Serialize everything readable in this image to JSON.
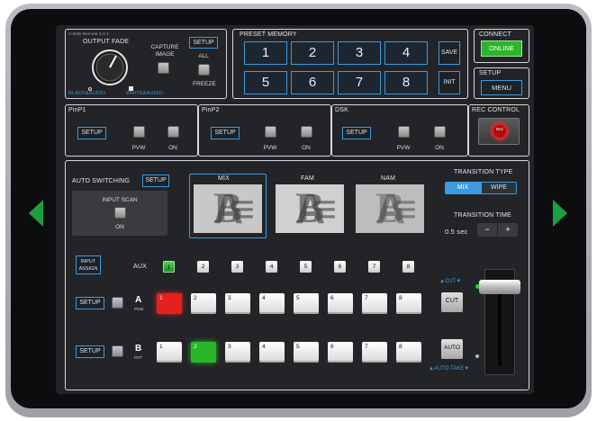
{
  "device": {
    "version": "V-8HD Remote 1.0.1"
  },
  "output_fade": {
    "title": "OUTPUT FADE",
    "left_label": "BLACK&AUDIO",
    "right_label": "WHITE&AUDIO"
  },
  "capture": {
    "label": "CAPTURE IMAGE"
  },
  "top_setup": {
    "label": "SETUP",
    "all_label": "ALL",
    "freeze_label": "FREEZE"
  },
  "preset_memory": {
    "title": "PRESET MEMORY",
    "buttons": [
      "1",
      "2",
      "3",
      "4",
      "5",
      "6",
      "7",
      "8"
    ],
    "save_label": "SAVE",
    "init_label": "INIT"
  },
  "connect": {
    "title": "CONNECT",
    "button": "ONLINE"
  },
  "setup_menu": {
    "title": "SETUP",
    "button": "MENU"
  },
  "pinp1": {
    "title": "PinP1",
    "setup": "SETUP",
    "pvw": "PVW",
    "on": "ON"
  },
  "pinp2": {
    "title": "PinP2",
    "setup": "SETUP",
    "pvw": "PVW",
    "on": "ON"
  },
  "dsk": {
    "title": "DSK",
    "setup": "SETUP",
    "pvw": "PVW",
    "on": "ON"
  },
  "rec_control": {
    "title": "REC CONTROL",
    "button": "Rec"
  },
  "auto_switching": {
    "title": "AUTO SWITCHING",
    "setup": "SETUP",
    "input_scan": "INPUT SCAN",
    "on": "ON"
  },
  "transition_thumbs": [
    {
      "label": "MIX"
    },
    {
      "label": "FAM"
    },
    {
      "label": "NAM"
    }
  ],
  "transition_type": {
    "title": "TRANSITION TYPE",
    "options": [
      "MIX",
      "WIPE"
    ],
    "selected": "MIX"
  },
  "transition_time": {
    "title": "TRANSITION TIME",
    "value": "0.5 sec",
    "minus": "−",
    "plus": "+"
  },
  "input_assign": {
    "label": "INPUT ASSIGN"
  },
  "aux_row": {
    "label": "AUX",
    "buttons": [
      "1",
      "2",
      "3",
      "4",
      "5",
      "6",
      "7",
      "8"
    ],
    "active_index": 0
  },
  "a_bus": {
    "setup": "SETUP",
    "letter": "A",
    "sub": "PGM",
    "buttons": [
      "1",
      "2",
      "3",
      "4",
      "5",
      "6",
      "7",
      "8"
    ],
    "active_index": 0,
    "active_color": "#e52020"
  },
  "b_bus": {
    "setup": "SETUP",
    "letter": "B",
    "sub": "PST",
    "buttons": [
      "1",
      "2",
      "3",
      "4",
      "5",
      "6",
      "7",
      "8"
    ],
    "active_index": 1,
    "active_color": "#2bb52b"
  },
  "cut": {
    "top_label": "▲CUT▼",
    "button": "CUT"
  },
  "auto": {
    "button": "AUTO",
    "bottom_label": "▲AUTO TAKE▼"
  },
  "nav": {
    "left": "previous-arrow-icon",
    "right": "next-arrow-icon",
    "color": "#1aa040"
  },
  "colors": {
    "accent": "#3a9be0",
    "online": "#2bb52b",
    "rec": "#e52020"
  }
}
